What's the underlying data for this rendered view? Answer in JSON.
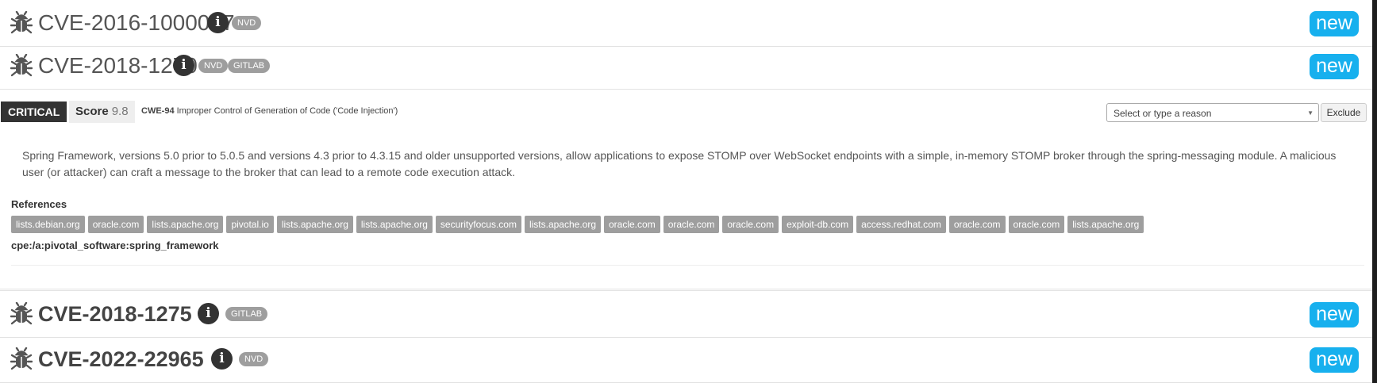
{
  "entries": [
    {
      "id": "CVE-2016-1000027",
      "sources": [
        "NVD"
      ],
      "badge": "new"
    },
    {
      "id": "CVE-2018-1270",
      "sources": [
        "NVD",
        "GITLAB"
      ],
      "badge": "new"
    },
    {
      "id": "CVE-2018-1275",
      "sources": [
        "GITLAB"
      ],
      "badge": "new"
    },
    {
      "id": "CVE-2022-22965",
      "sources": [
        "NVD"
      ],
      "badge": "new"
    }
  ],
  "info_glyph": "i",
  "details": {
    "severity": "CRITICAL",
    "score_label": "Score",
    "score_value": "9.8",
    "cwe_code": "CWE-94",
    "cwe_text": "Improper Control of Generation of Code ('Code Injection')",
    "reason_placeholder": "Select or type a reason",
    "exclude_label": "Exclude",
    "description": "Spring Framework, versions 5.0 prior to 5.0.5 and versions 4.3 prior to 4.3.15 and older unsupported versions, allow applications to expose STOMP over WebSocket endpoints with a simple, in-memory STOMP broker through the spring-messaging module. A malicious user (or attacker) can craft a message to the broker that can lead to a remote code execution attack.",
    "references_label": "References",
    "references": [
      "lists.debian.org",
      "oracle.com",
      "lists.apache.org",
      "pivotal.io",
      "lists.apache.org",
      "lists.apache.org",
      "securityfocus.com",
      "lists.apache.org",
      "oracle.com",
      "oracle.com",
      "oracle.com",
      "exploit-db.com",
      "access.redhat.com",
      "oracle.com",
      "oracle.com",
      "lists.apache.org"
    ],
    "cpe": "cpe:/a:pivotal_software:spring_framework"
  },
  "colors": {
    "new_badge": "#17b0ee",
    "severity_bg": "#333333",
    "tag_bg": "#9e9e9e"
  },
  "icons": {
    "entry": "bug-icon",
    "info": "info-icon",
    "dropdown": "chevron-down-icon"
  }
}
